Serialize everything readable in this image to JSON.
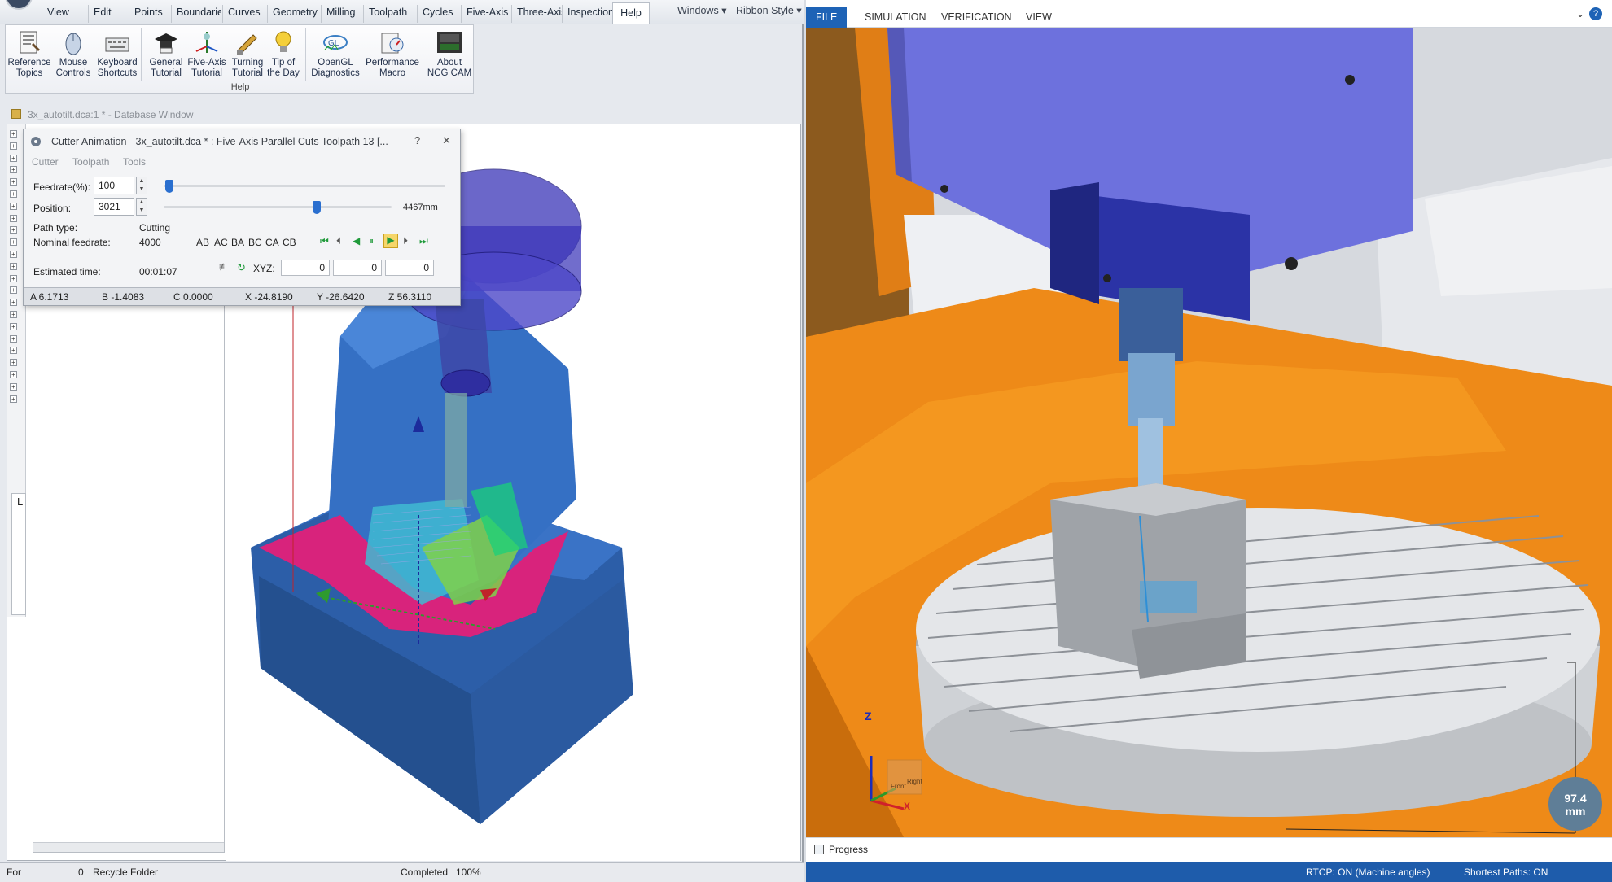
{
  "left_app": {
    "menu_tabs": [
      "View",
      "Edit",
      "Points",
      "Boundarie",
      "Curves",
      "Geometry",
      "Milling",
      "Toolpath",
      "Cycles",
      "Five-Axis",
      "Three-Axis",
      "Inspection",
      "Help"
    ],
    "active_tab": "Help",
    "windows_label": "Windows",
    "ribbon_style_label": "Ribbon Style",
    "ribbon": {
      "buttons": [
        {
          "line1": "Reference",
          "line2": "Topics",
          "icon": "book-icon"
        },
        {
          "line1": "Mouse",
          "line2": "Controls",
          "icon": "mouse-icon"
        },
        {
          "line1": "Keyboard",
          "line2": "Shortcuts",
          "icon": "keyboard-icon"
        },
        {
          "line1": "General",
          "line2": "Tutorial",
          "icon": "graduation-cap-icon"
        },
        {
          "line1": "Five-Axis",
          "line2": "Tutorial",
          "icon": "five-axis-icon"
        },
        {
          "line1": "Turning",
          "line2": "Tutorial",
          "icon": "turning-tool-icon"
        },
        {
          "line1": "Tip of",
          "line2": "the Day",
          "icon": "lightbulb-icon"
        },
        {
          "line1": "OpenGL",
          "line2": "Diagnostics",
          "icon": "opengl-icon"
        },
        {
          "line1": "Performance",
          "line2": "Macro",
          "icon": "performance-icon"
        },
        {
          "line1": "About",
          "line2": "NCG CAM",
          "icon": "ncg-cam-logo-icon"
        }
      ],
      "group_label": "Help"
    },
    "db_window_title": "3x_autotilt.dca:1 * - Database Window",
    "tree_label": "L",
    "cutter_dialog": {
      "title": "Cutter Animation - 3x_autotilt.dca * : Five-Axis Parallel Cuts Toolpath 13 [...",
      "help": "?",
      "close": "✕",
      "menu": [
        "Cutter",
        "Toolpath",
        "Tools"
      ],
      "feedrate_label": "Feedrate(%):",
      "feedrate_value": "100",
      "feedrate_fraction": 0.02,
      "position_label": "Position:",
      "position_value": "3021",
      "position_fraction": 0.67,
      "position_length": "4467mm",
      "path_type_label": "Path type:",
      "path_type_value": "Cutting",
      "nominal_feedrate_label": "Nominal feedrate:",
      "nominal_feedrate_value": "4000",
      "axis_pairs": [
        "AB",
        "AC",
        "BA",
        "BC",
        "CA",
        "CB"
      ],
      "estimated_time_label": "Estimated time:",
      "estimated_time_value": "00:01:07",
      "xyz_label": "XYZ:",
      "xyz_values": [
        "0",
        "0",
        "0"
      ],
      "coords": [
        "A 6.1713",
        "B -1.4083",
        "C 0.0000",
        "X -24.8190",
        "Y -26.6420",
        "Z 56.3110"
      ]
    },
    "status": {
      "left": "For",
      "count": "0",
      "folder": "Recycle Folder",
      "completed": "Completed",
      "percent": "100%"
    }
  },
  "right_app": {
    "tabs": [
      "FILE",
      "SIMULATION",
      "VERIFICATION",
      "VIEW"
    ],
    "active_tab": "FILE",
    "progress_label": "Progress",
    "status": {
      "rtcp": "RTCP: ON (Machine angles)",
      "shortest": "Shortest Paths: ON"
    },
    "dimension_value": "97.4",
    "dimension_unit": "mm",
    "triad": {
      "z": "Z",
      "x": "X"
    },
    "view_cube": {
      "front": "Front",
      "right": "Right"
    }
  },
  "colors": {
    "ribbon_accent": "#1e63b6",
    "part_blue": "#2f63b8",
    "machine_orange": "#ef8a1c",
    "spindle_purple": "#6c6fd8"
  }
}
